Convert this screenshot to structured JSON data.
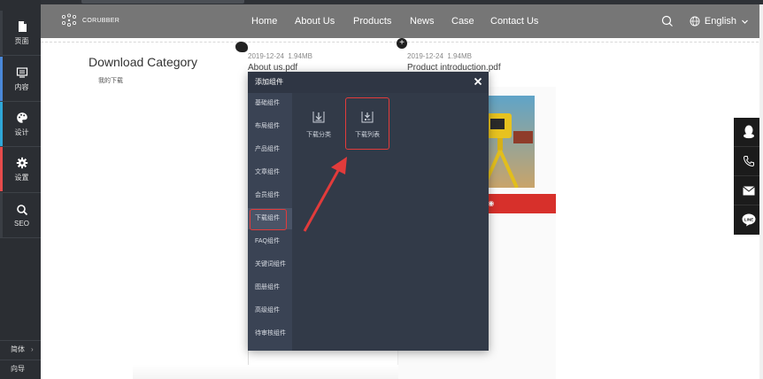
{
  "sidebar": {
    "items": [
      {
        "label": "页面",
        "icon": "page-icon"
      },
      {
        "label": "内容",
        "icon": "content-icon"
      },
      {
        "label": "设计",
        "icon": "palette-icon"
      },
      {
        "label": "设置",
        "icon": "gear-icon"
      },
      {
        "label": "SEO",
        "icon": "search-icon"
      }
    ],
    "bottom": [
      {
        "label": "简体"
      },
      {
        "label": "向导"
      }
    ],
    "bottom_arrow": "›"
  },
  "navbar": {
    "logo_text": "CORUBBER",
    "links": [
      "Home",
      "About Us",
      "Products",
      "News",
      "Case",
      "Contact Us"
    ],
    "language": "English",
    "bg_color": "#767676"
  },
  "page": {
    "download_title": "Download Category",
    "download_sub": "我的下载",
    "files": [
      {
        "date": "2019-12-24",
        "size": "1.94MB",
        "name": "About us.pdf"
      },
      {
        "date": "2019-12-24",
        "size": "1.94MB",
        "name": "Product introduction.pdf"
      }
    ],
    "card_bar_text": "re",
    "accent_red": "#d7302b"
  },
  "modal": {
    "title": "添加组件",
    "close": "×",
    "menu": [
      "基础组件",
      "布局组件",
      "产品组件",
      "文章组件",
      "会员组件",
      "下载组件",
      "FAQ组件",
      "关键词组件",
      "图册组件",
      "高级组件",
      "待审核组件"
    ],
    "active_index": 5,
    "components": [
      {
        "label": "下载分类",
        "icon": "download-category-icon"
      },
      {
        "label": "下载列表",
        "icon": "download-list-icon"
      }
    ]
  }
}
